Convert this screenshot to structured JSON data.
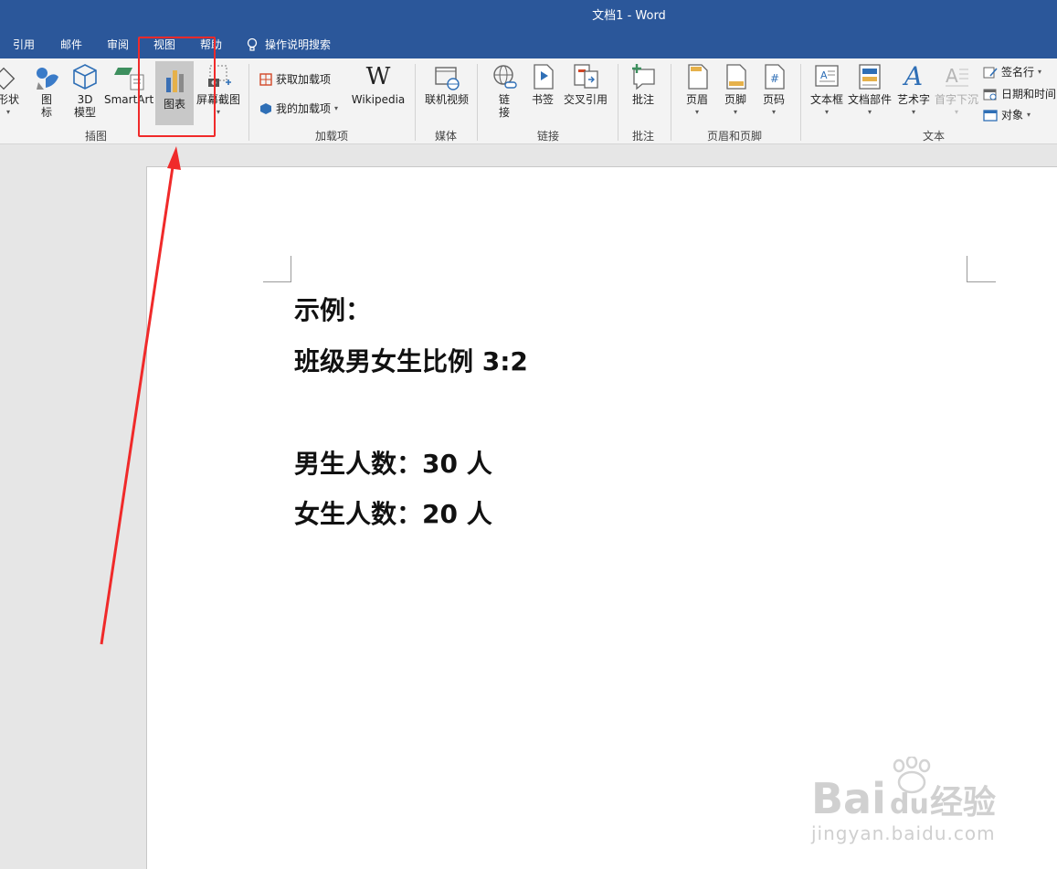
{
  "window": {
    "title": "文档1  -  Word"
  },
  "tabs": [
    "引用",
    "邮件",
    "审阅",
    "视图",
    "帮助"
  ],
  "tell_me": "操作说明搜索",
  "ribbon": {
    "illustrations": {
      "shapes": "形状",
      "icons_1": "图",
      "icons_2": "标",
      "model_1": "3D",
      "model_2": "模型",
      "smartart": "SmartArt",
      "chart": "图表",
      "screenshot": "屏幕截图",
      "group": "插图"
    },
    "addins": {
      "get": "获取加载项",
      "mine": "我的加载项",
      "wikipedia": "Wikipedia",
      "group": "加载项"
    },
    "media": {
      "online_video": "联机视频",
      "group": "媒体"
    },
    "links": {
      "link_1": "链",
      "link_2": "接",
      "bookmark": "书签",
      "crossref": "交叉引用",
      "group": "链接"
    },
    "comments": {
      "comment": "批注",
      "group": "批注"
    },
    "header_footer": {
      "header": "页眉",
      "footer": "页脚",
      "page_number": "页码",
      "group": "页眉和页脚"
    },
    "text": {
      "textbox": "文本框",
      "quickparts": "文档部件",
      "wordart": "艺术字",
      "dropcap": "首字下沉",
      "signature": "签名行",
      "datetime": "日期和时间",
      "object": "对象",
      "group": "文本"
    }
  },
  "document": {
    "line1": "示例：",
    "line2": "班级男女生比例  3:2",
    "line3": "男生人数：30 人",
    "line4": "女生人数：20 人"
  },
  "watermark": {
    "brand": "Bai",
    "brand2": "du",
    "cn": "经验",
    "url": "jingyan.baidu.com"
  },
  "colors": {
    "titlebar": "#2b579a",
    "highlight": "#f02a2a"
  }
}
